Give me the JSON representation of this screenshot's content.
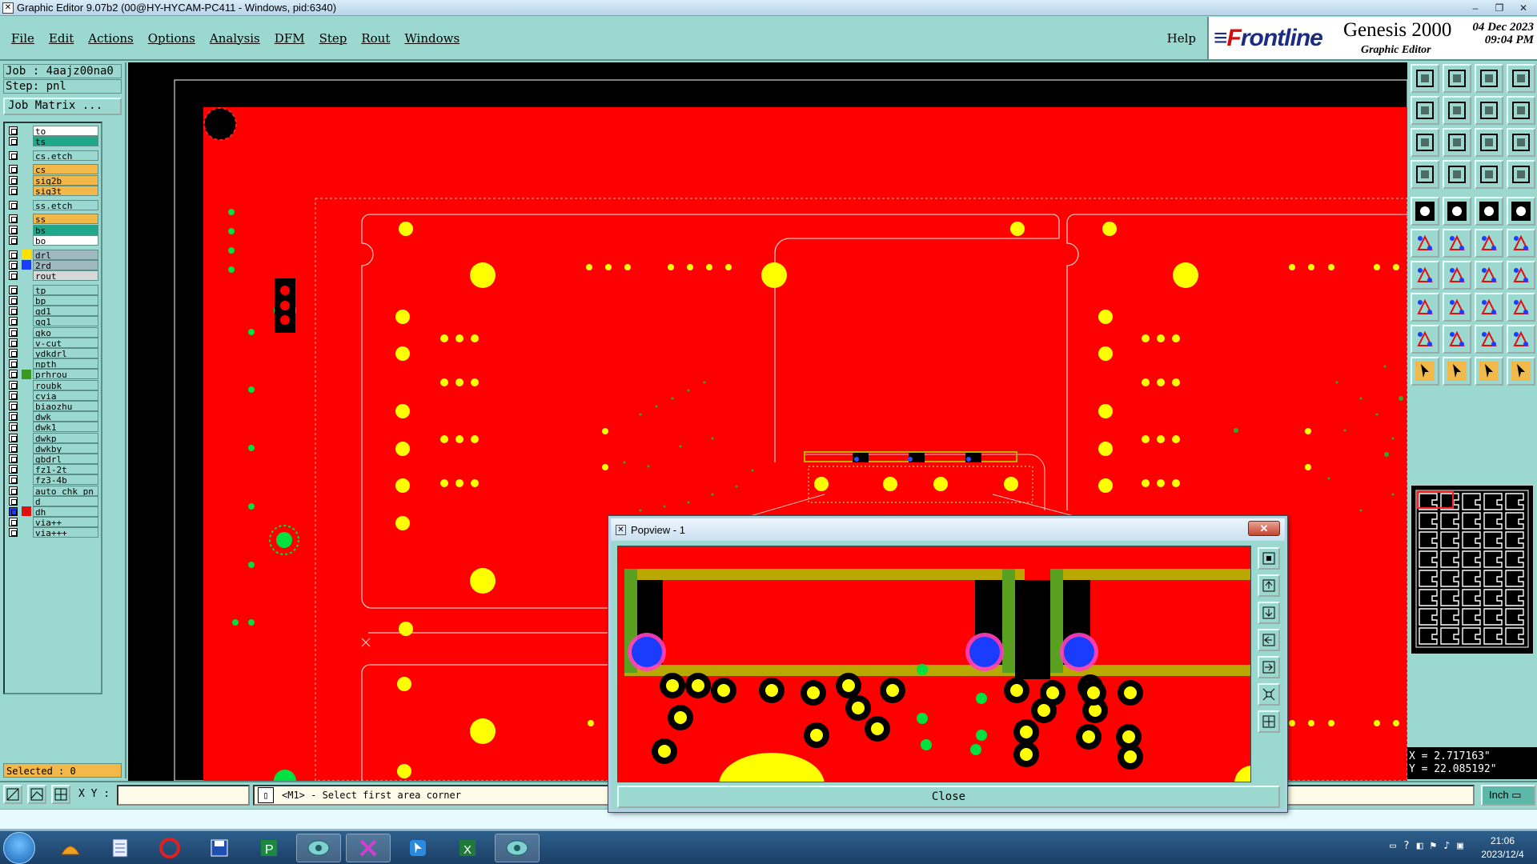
{
  "window": {
    "title": "Graphic Editor 9.07b2 (00@HY-HYCAM-PC411 - Windows, pid:6340)"
  },
  "menu": {
    "items": [
      "File",
      "Edit",
      "Actions",
      "Options",
      "Analysis",
      "DFM",
      "Step",
      "Rout",
      "Windows"
    ],
    "help": "Help"
  },
  "brand": {
    "logo_pre": "F",
    "logo_rest": "rontline",
    "product": "Genesis 2000",
    "subtitle": "Graphic Editor",
    "date": "04 Dec 2023",
    "time": "09:04 PM"
  },
  "job": {
    "job_label": "Job : 4aajz00na0",
    "step_label": "Step: pnl",
    "matrix_button": "Job Matrix ..."
  },
  "layers": [
    {
      "name": "to",
      "color": "#ffffff"
    },
    {
      "name": "ts",
      "color": "#1fa88a"
    },
    {
      "name": "cs.etch",
      "color": "#9ad8d0"
    },
    {
      "name": "cs",
      "color": "#f2b84a"
    },
    {
      "name": "sig2b",
      "color": "#f2b84a"
    },
    {
      "name": "sig3t",
      "color": "#f2b84a"
    },
    {
      "name": "ss.etch",
      "color": "#9ad8d0"
    },
    {
      "name": "ss",
      "color": "#f2b84a"
    },
    {
      "name": "bs",
      "color": "#1fa88a"
    },
    {
      "name": "bo",
      "color": "#ffffff"
    },
    {
      "name": "drl",
      "color": "#a0b8c0",
      "swatch": "#ffe000"
    },
    {
      "name": "2rd",
      "color": "#a0b8c0",
      "swatch": "#1a3cff"
    },
    {
      "name": "rout",
      "color": "#d8d8d8"
    },
    {
      "name": "tp",
      "color": "#9ad8d0"
    },
    {
      "name": "bp",
      "color": "#9ad8d0"
    },
    {
      "name": "gd1",
      "color": "#9ad8d0"
    },
    {
      "name": "gg1",
      "color": "#9ad8d0"
    },
    {
      "name": "gko",
      "color": "#9ad8d0"
    },
    {
      "name": "v-cut",
      "color": "#9ad8d0"
    },
    {
      "name": "ydkdrl",
      "color": "#9ad8d0"
    },
    {
      "name": "npth",
      "color": "#9ad8d0"
    },
    {
      "name": "prhrou",
      "color": "#9ad8d0",
      "swatch": "#3a9a20"
    },
    {
      "name": "roubk",
      "color": "#9ad8d0"
    },
    {
      "name": "cvia",
      "color": "#9ad8d0"
    },
    {
      "name": "biaozhu",
      "color": "#9ad8d0"
    },
    {
      "name": "dwk",
      "color": "#9ad8d0"
    },
    {
      "name": "dwk1",
      "color": "#9ad8d0"
    },
    {
      "name": "dwkp",
      "color": "#9ad8d0"
    },
    {
      "name": "dwkby",
      "color": "#9ad8d0"
    },
    {
      "name": "gbdrl",
      "color": "#9ad8d0"
    },
    {
      "name": "fz1-2t",
      "color": "#9ad8d0"
    },
    {
      "name": "fz3-4b",
      "color": "#9ad8d0"
    },
    {
      "name": "auto_chk_pn",
      "color": "#9ad8d0"
    },
    {
      "name": "d",
      "color": "#9ad8d0"
    },
    {
      "name": "dh",
      "color": "#9ad8d0",
      "swatch": "#e01010",
      "selected": true
    },
    {
      "name": "via++",
      "color": "#9ad8d0"
    },
    {
      "name": "via+++",
      "color": "#9ad8d0"
    }
  ],
  "selected": "Selected : 0",
  "coords": {
    "x": "X = 2.717163\"",
    "y": "Y = 22.085192\""
  },
  "bottom": {
    "xy_label": "X Y :",
    "xy_value": "",
    "prompt": "<M1> - Select first area corner",
    "units": "Inch"
  },
  "popview": {
    "title": "Popview - 1",
    "close_label": "Close"
  },
  "taskbar": {
    "time": "21:06",
    "date": "2023/12/4"
  },
  "colors": {
    "board": "#ff0000",
    "pad": "#ffff00",
    "drill": "#00e040",
    "panel_bg": "#9ad8d0"
  },
  "icons": [
    "zoom-home-icon",
    "zoom-in-icon",
    "zoom-out-icon",
    "fit-icon",
    "pan-icon",
    "snap-icon",
    "measure-icon",
    "select-icon"
  ]
}
